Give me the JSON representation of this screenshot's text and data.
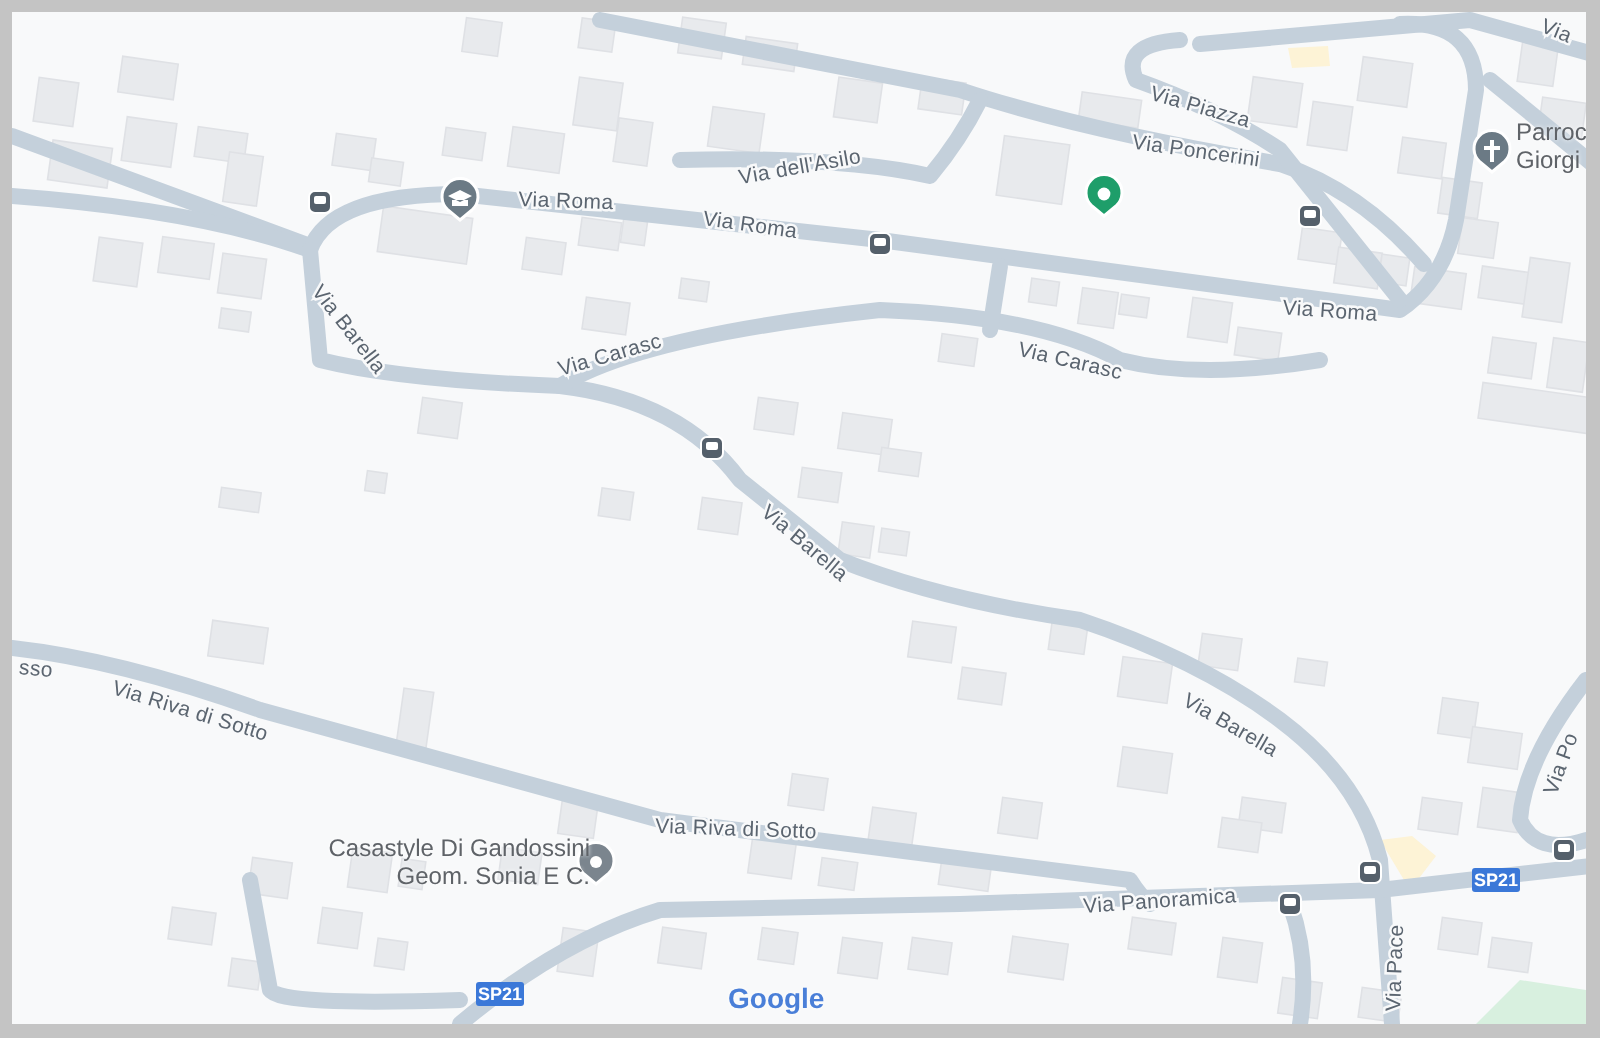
{
  "map": {
    "street_labels": [
      "Via Roma",
      "Via Roma",
      "Via Roma",
      "Via dell'Asilo",
      "Via Piazza",
      "Via Poncerini",
      "Via Carasc",
      "Via Carasc",
      "Via Barella",
      "Via Barella",
      "Via Barella",
      "Via Riva di Sotto",
      "Via Riva di Sotto",
      "Via Panoramica",
      "Via Pace",
      "Via Po",
      "Via",
      "sso"
    ],
    "places": [
      {
        "name": "Parroc\nGiorgi",
        "kind": "church"
      },
      {
        "name": "Casastyle Di Gandossini\nGeom. Sonia E C.",
        "kind": "business"
      }
    ],
    "road_shields": [
      "SP21",
      "SP21"
    ],
    "attribution": "Google"
  }
}
